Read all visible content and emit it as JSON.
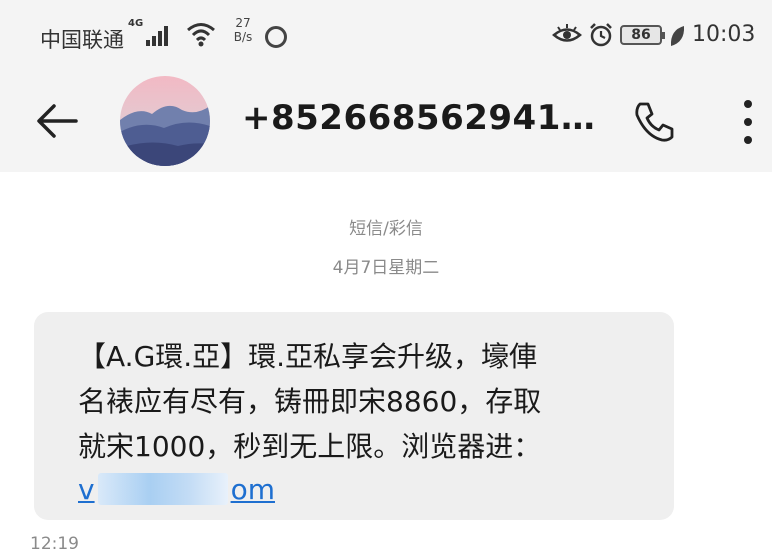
{
  "status_bar": {
    "carrier": "中国联通",
    "network": "4G",
    "speed_value": "27",
    "speed_unit": "B/s",
    "battery": "86",
    "time": "10:03"
  },
  "header": {
    "contact": "+8526685629414...",
    "back_icon": "back-arrow-icon",
    "call_icon": "phone-icon",
    "more_icon": "more-vertical-icon"
  },
  "conversation": {
    "message_type": "短信/彩信",
    "date": "4月7日星期二",
    "message": {
      "lines": [
        "【A.G環.亞】環.亞私享会升级，壕俥",
        "名裱应有尽有，铸冊即宋8860，存取",
        "就宋1000，秒到无上限。浏览器进："
      ],
      "link_start": "v",
      "link_end": "om",
      "time": "12:19"
    }
  },
  "colors": {
    "header_bg": "#f4f4f4",
    "bubble_bg": "#efefef",
    "link": "#1e6fd0",
    "meta_text": "#8a8a8a"
  }
}
